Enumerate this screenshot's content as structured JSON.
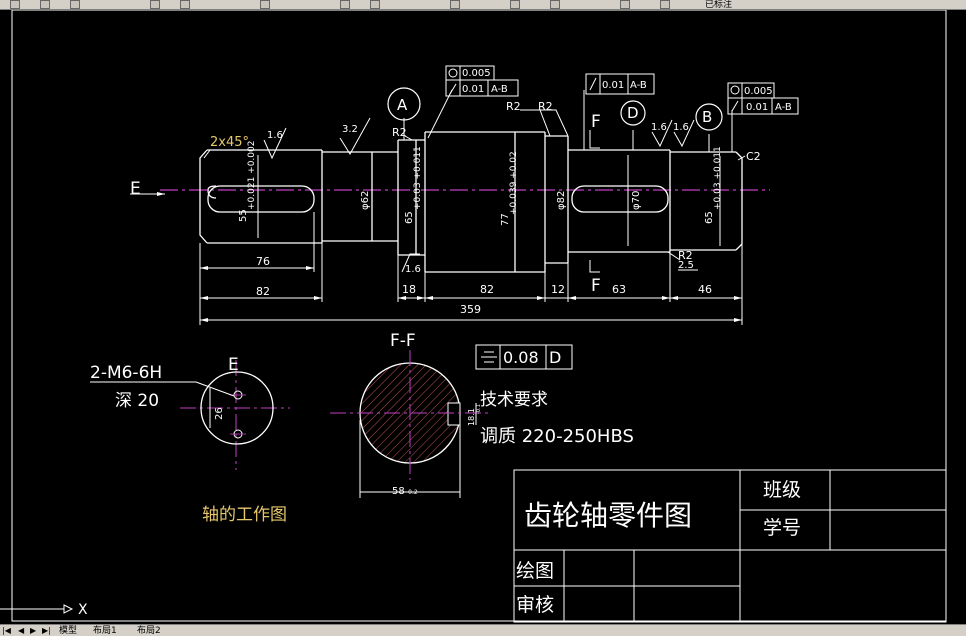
{
  "app": {
    "toolbar_label": "已标注",
    "model_tabs": [
      "模型",
      "布局1",
      "布局2"
    ],
    "ucs_axis": "X"
  },
  "drawing": {
    "title": "齿轮轴零件图",
    "table": {
      "class": "班级",
      "student_no": "学号",
      "drawn": "绘图",
      "checked": "审核"
    },
    "section_view": "F-F",
    "view_e": "E",
    "work_caption": "轴的工作图",
    "tech_title": "技术要求",
    "tech_req": "调质 220-250HBS",
    "thread_note": "2-M6-6H",
    "thread_depth": "深 20",
    "datums": [
      "A",
      "D",
      "B"
    ],
    "gdt": {
      "tol1": "0.005",
      "tol2": "0.01",
      "ref2": "A-B",
      "tol3": "0.01",
      "ref3": "A-B",
      "tol4": "0.005",
      "tol5": "0.01",
      "ref5": "A-B",
      "sym_value": "0.08",
      "sym_datum": "D"
    },
    "dims": {
      "chamfer": "2x45°",
      "rough_16": "1.6",
      "rough_32": "3.2",
      "r2": "R2",
      "c2": "C2",
      "d55": "55",
      "d55_tol": "+0.021 +0.002",
      "d62": "φ62",
      "d65a": "65",
      "d65a_tol": "+0.03 +0.011",
      "d77": "77",
      "d77_tol": "+0.039 +0.02",
      "d82v": "φ82",
      "d70v": "φ70",
      "d65b": "65",
      "d65b_tol": "+0.03 +0.011",
      "l76": "76",
      "l82a": "82",
      "l18": "18",
      "l82b": "82",
      "l12": "12",
      "l63": "63",
      "l46": "46",
      "l359": "359",
      "l25": "2.5",
      "key_w": "26",
      "sec_w": "58",
      "sec_tol": "-0.2",
      "key_h": "18.1",
      "key_h_tol": "-0.1",
      "F": "F"
    }
  }
}
